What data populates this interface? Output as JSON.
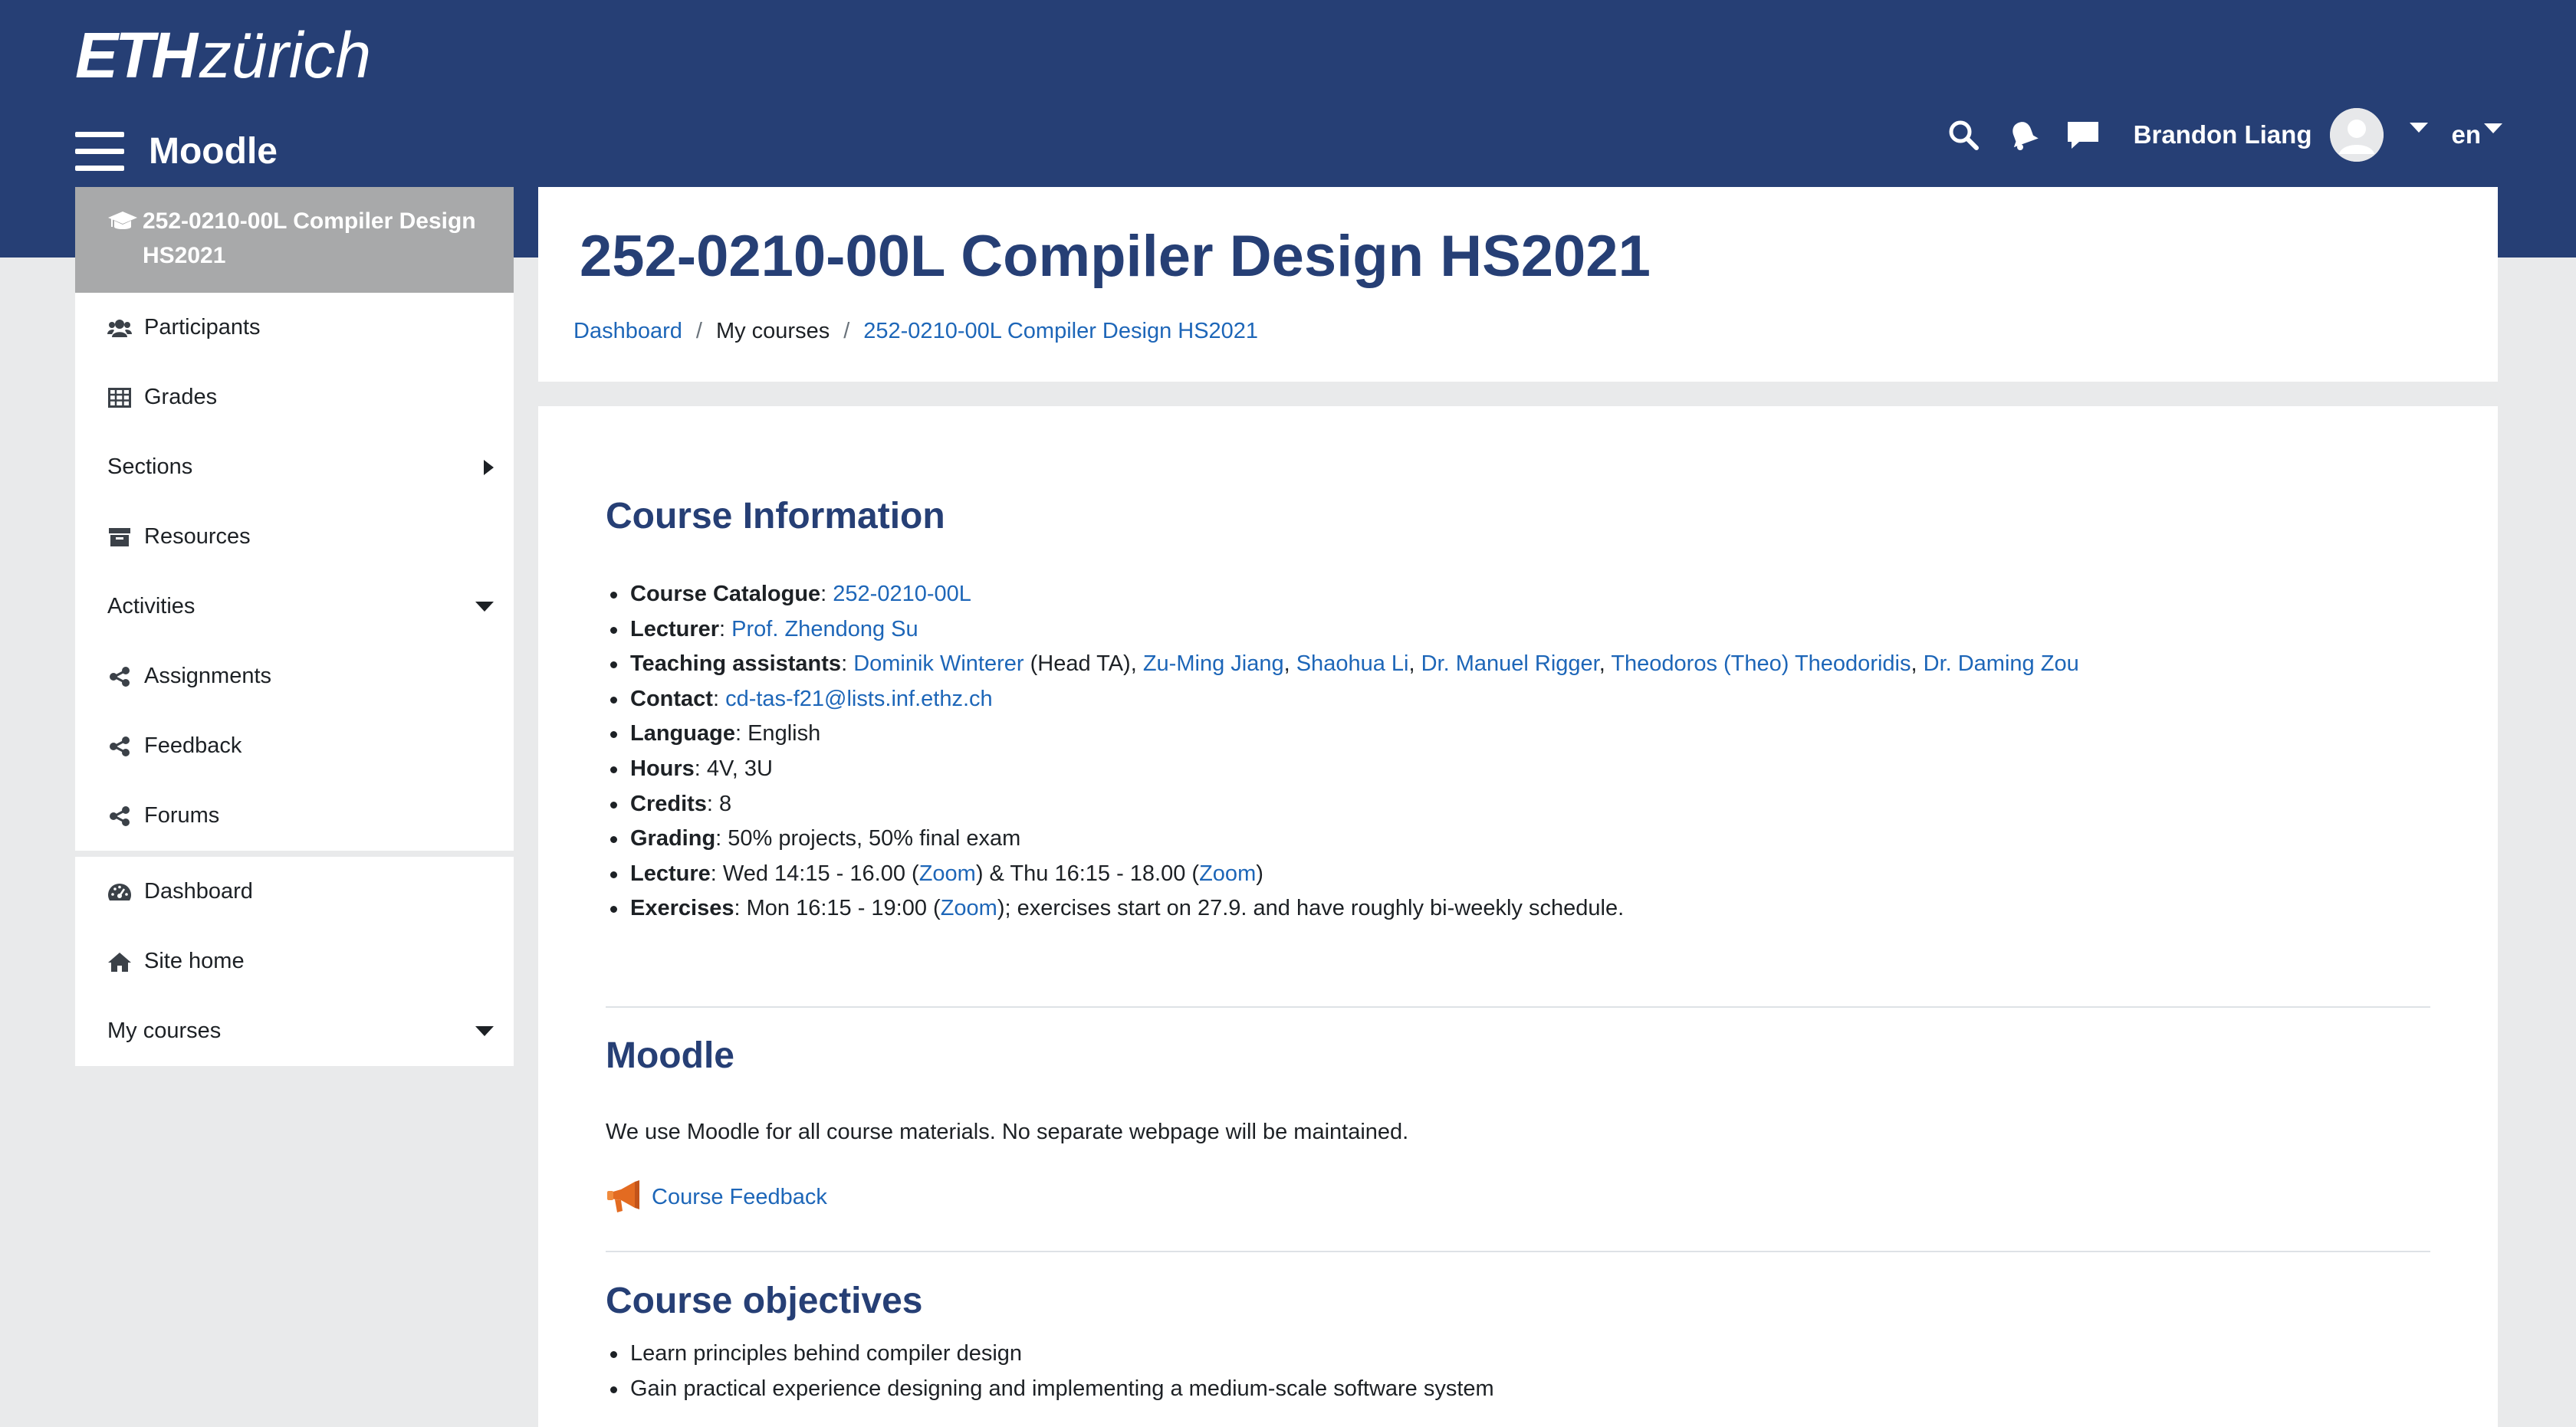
{
  "header": {
    "logo_eth": "ETH",
    "logo_zurich": "zürich",
    "site_name": "Moodle",
    "user_name": "Brandon Liang",
    "language": "en"
  },
  "sidebar": {
    "course": "252-0210-00L Compiler Design HS2021",
    "course_items": [
      {
        "label": "Participants",
        "icon": "users-icon"
      },
      {
        "label": "Grades",
        "icon": "table-icon"
      },
      {
        "label": "Sections",
        "icon": "chevron-right-icon"
      },
      {
        "label": "Resources",
        "icon": "archive-icon"
      },
      {
        "label": "Activities",
        "icon": "chevron-down-icon"
      },
      {
        "label": "Assignments",
        "icon": "share-icon"
      },
      {
        "label": "Feedback",
        "icon": "share-icon"
      },
      {
        "label": "Forums",
        "icon": "share-icon"
      }
    ],
    "site_items": [
      {
        "label": "Dashboard",
        "icon": "dashboard-icon"
      },
      {
        "label": "Site home",
        "icon": "home-icon"
      },
      {
        "label": "My courses",
        "icon": "chevron-down-icon"
      }
    ]
  },
  "page": {
    "title": "252-0210-00L Compiler Design HS2021",
    "breadcrumb": [
      "Dashboard",
      "My courses",
      "252-0210-00L Compiler Design HS2021"
    ]
  },
  "course_info": {
    "heading": "Course Information",
    "catalogue_label": "Course Catalogue",
    "catalogue_value": "252-0210-00L",
    "lecturer_label": "Lecturer",
    "lecturer_value": "Prof. Zhendong Su",
    "tas_label": "Teaching assistants",
    "tas": [
      "Dominik Winterer",
      "Zu-Ming Jiang",
      "Shaohua Li",
      "Dr. Manuel Rigger",
      "Theodoros (Theo) Theodoridis",
      "Dr. Daming Zou"
    ],
    "head_ta_note": "(Head TA)",
    "contact_label": "Contact",
    "contact_value": "cd-tas-f21@lists.inf.ethz.ch",
    "language_label": "Language",
    "language_value": "English",
    "hours_label": "Hours",
    "hours_value": "4V, 3U",
    "credits_label": "Credits",
    "credits_value": "8",
    "grading_label": "Grading",
    "grading_value": "50% projects, 50% final exam",
    "lecture_label": "Lecture",
    "lecture_wed": "Wed 14:15 - 16.00",
    "lecture_thu": "Thu 16:15 - 18.00",
    "zoom": "Zoom",
    "exercises_label": "Exercises",
    "exercises_time": "Mon 16:15 - 19:00",
    "exercises_note": "; exercises start on 27.9. and have roughly bi-weekly schedule."
  },
  "moodle_section": {
    "heading": "Moodle",
    "text": "We use Moodle for all course materials. No separate webpage will be maintained.",
    "feedback_link": "Course Feedback"
  },
  "objectives": {
    "heading": "Course objectives",
    "items": [
      "Learn principles behind compiler design",
      "Gain practical experience designing and implementing a medium-scale software system"
    ]
  }
}
